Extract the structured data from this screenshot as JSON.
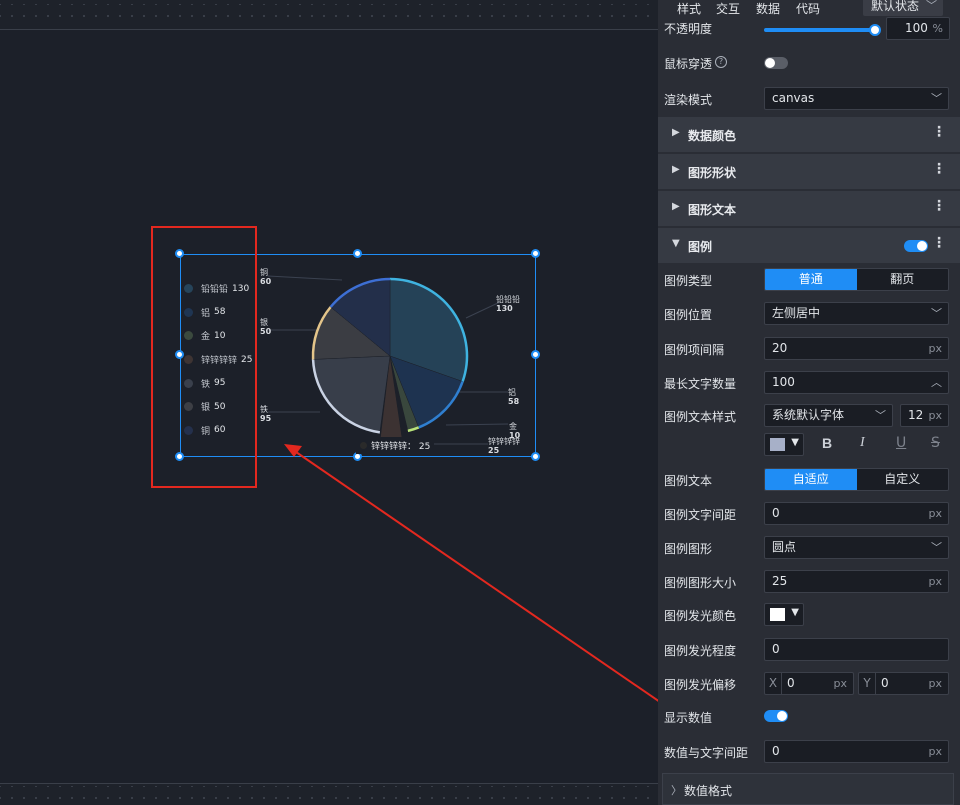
{
  "panel": {
    "tabs": [
      "样式",
      "交互",
      "数据",
      "代码"
    ],
    "state_select": "默认状态",
    "opacity_label": "不透明度",
    "opacity_value": "100",
    "opacity_unit": "%",
    "opacity_level": 1.0,
    "mouse_through_label": "鼠标穿透",
    "render_mode_label": "渲染模式",
    "render_mode_value": "canvas",
    "sections": {
      "data_color": "数据颜色",
      "shape_style": "图形形状",
      "shape_text": "图形文本",
      "legend": "图例",
      "value_format": "数值格式"
    },
    "legend_type_label": "图例类型",
    "legend_type_options": [
      "普通",
      "翻页"
    ],
    "legend_position_label": "图例位置",
    "legend_position_value": "左侧居中",
    "legend_gap_label": "图例项间隔",
    "legend_gap_value": "20",
    "max_text_label": "最长文字数量",
    "max_text_value": "100",
    "text_style_label": "图例文本样式",
    "font_value": "系统默认字体",
    "font_size_value": "12",
    "text_color": "#a7b0c8",
    "format_buttons": [
      "B",
      "I",
      "U",
      "S"
    ],
    "legend_text_label": "图例文本",
    "legend_text_options": [
      "自适应",
      "自定义"
    ],
    "text_spacing_label": "图例文字间距",
    "text_spacing_value": "0",
    "shape_label": "图例图形",
    "shape_value": "圆点",
    "shape_size_label": "图例图形大小",
    "shape_size_value": "25",
    "glow_color_label": "图例发光颜色",
    "glow_color": "#ffffff",
    "glow_level_label": "图例发光程度",
    "glow_level_value": "0",
    "glow_offset_label": "图例发光偏移",
    "glow_x_label": "X",
    "glow_x_value": "0",
    "glow_y_label": "Y",
    "glow_y_value": "0",
    "show_value_label": "显示数值",
    "value_spacing_label": "数值与文字间距",
    "value_spacing_value": "0",
    "unit_px": "px"
  },
  "legend_items": [
    {
      "name": "铅铅铅",
      "value": "130",
      "color": "#26445a"
    },
    {
      "name": "铝",
      "value": "58",
      "color": "#1f3552"
    },
    {
      "name": "金",
      "value": "10",
      "color": "#3b4a3e"
    },
    {
      "name": "锌锌锌锌",
      "value": "25",
      "color": "#3e3433"
    },
    {
      "name": "铁",
      "value": "95",
      "color": "#3a404c"
    },
    {
      "name": "银",
      "value": "50",
      "color": "#3d3f45"
    },
    {
      "name": "铜",
      "value": "60",
      "color": "#24304c"
    }
  ],
  "slice_labels": [
    {
      "name": "铅铅铅",
      "value": "130"
    },
    {
      "name": "铝",
      "value": "58"
    },
    {
      "name": "金",
      "value": "10"
    },
    {
      "name": "锌锌锌锌",
      "value": "25"
    },
    {
      "name": "铁",
      "value": "95"
    },
    {
      "name": "银",
      "value": "50"
    },
    {
      "name": "铜",
      "value": "60"
    }
  ],
  "tooltip": {
    "text": "锌锌锌锌：  25"
  },
  "chart_data": {
    "type": "pie",
    "categories": [
      "铅铅铅",
      "铝",
      "金",
      "锌锌锌锌",
      "铁",
      "银",
      "铜"
    ],
    "values": [
      130,
      58,
      10,
      25,
      95,
      50,
      60
    ],
    "colors": [
      "#26445a",
      "#1f3552",
      "#3b4a3e",
      "#3e3433",
      "#3a404c",
      "#3d3f45",
      "#24304c"
    ],
    "edge_colors": [
      "#3fb3e0",
      "#2f7fd0",
      "#b9e37a",
      "#d7d2cf",
      "#c9d2e3",
      "#e4c58a",
      "#3d6fd4"
    ],
    "legend": "left-middle"
  }
}
